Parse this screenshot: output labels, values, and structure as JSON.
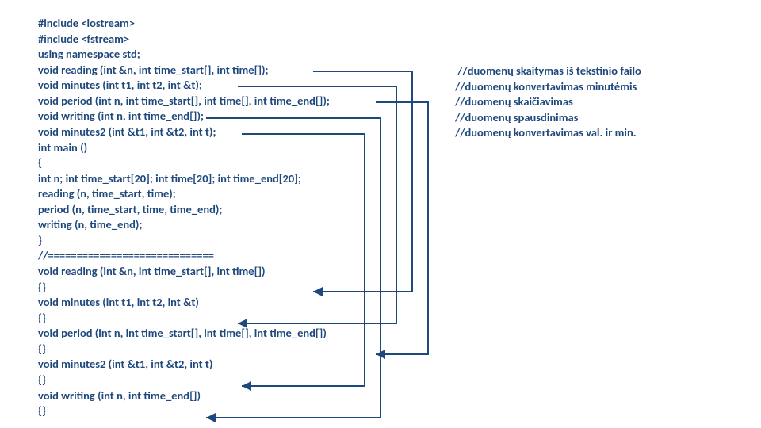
{
  "code": {
    "l1": "#include <iostream>",
    "l2": "#include <fstream>",
    "l3": "using namespace std;",
    "l4": "void reading (int &n, int time_start[], int time[]);",
    "l5": "void minutes (int t1, int t2, int &t);",
    "l6": "void period (int n, int time_start[], int time[], int time_end[]);",
    "l7": "void writing (int n, int time_end[]);",
    "l8": "void minutes2 (int &t1, int &t2, int t);",
    "l9": "int main ()",
    "l10": "{",
    "l11": "int n; int time_start[20]; int time[20]; int time_end[20];",
    "l12": "",
    "l13": "reading (n, time_start, time);",
    "l14": "period (n, time_start, time, time_end);",
    "l15": "writing (n, time_end);",
    "l16": "}",
    "l17": "//=============================",
    "l18": "void reading (int &n, int time_start[], int time[])",
    "l19": "{}",
    "l20": "void minutes (int t1, int t2, int &t)",
    "l21": "{}",
    "l22": "void period (int n, int time_start[], int time[], int time_end[])",
    "l23": "{}",
    "l24": "void minutes2 (int &t1, int &t2, int t)",
    "l25": "{}",
    "l26": "void writing (int n, int time_end[])",
    "l27": "{}"
  },
  "comments": {
    "c1": " //duomenų skaitymas iš tekstinio failo",
    "c2": "//duomenų konvertavimas minutėmis",
    "c3": "//duomenų skaičiavimas",
    "c4": "//duomenų spausdinimas",
    "c5": "//duomenų konvertavimas val. ir min."
  }
}
